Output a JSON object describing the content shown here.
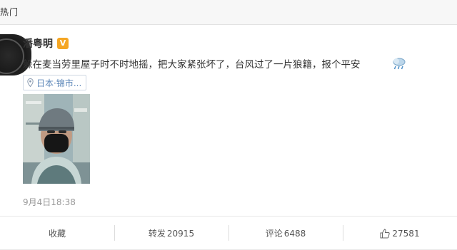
{
  "top_tab": {
    "label": "热门"
  },
  "post": {
    "username": "潘粤明",
    "verified_badge": "V",
    "text": "躲在麦当劳里屋子时不时地摇，把大家紧张坏了，台风过了一片狼籍，报个平安",
    "weather_icon": "cloud-rain-icon",
    "location": "日本·锦市...",
    "timestamp": "9月4日18:38"
  },
  "actions": {
    "favorite_label": "收藏",
    "repost_label": "转发",
    "repost_count": "20915",
    "comment_label": "评论",
    "comment_count": "6488",
    "like_count": "27581"
  },
  "colors": {
    "link_blue": "#5b86b8",
    "badge_orange": "#f5a623",
    "muted_gray": "#999999"
  }
}
